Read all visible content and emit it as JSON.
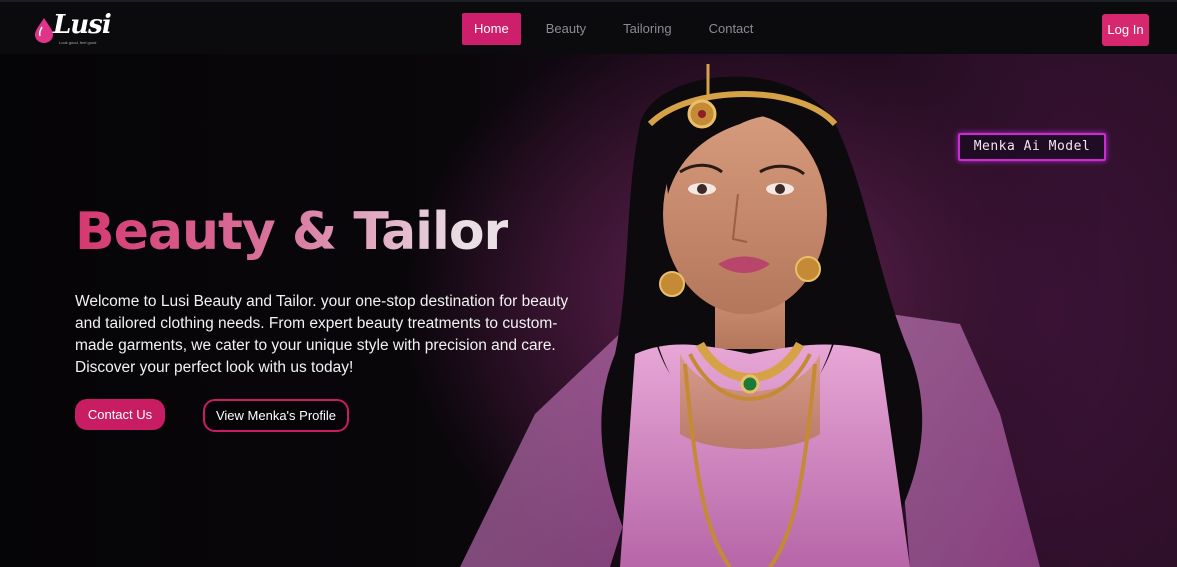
{
  "brand": {
    "name": "Lusi",
    "tagline": "Look good, feel good",
    "colors": {
      "accent": "#cd1f6b",
      "background": "#050406",
      "badge_border": "#c92dd2"
    }
  },
  "nav": {
    "items": [
      {
        "label": "Home",
        "active": true
      },
      {
        "label": "Beauty",
        "active": false
      },
      {
        "label": "Tailoring",
        "active": false
      },
      {
        "label": "Contact",
        "active": false
      }
    ],
    "login_label": "Log In"
  },
  "hero": {
    "title": "Beauty & Tailor",
    "description": "Welcome to Lusi Beauty and Tailor. your one-stop destination for beauty and tailored clothing needs. From expert beauty treatments to custom-made garments, we cater to your unique style with precision and care. Discover your perfect look with us today!",
    "contact_button": "Contact Us",
    "profile_button": "View Menka's Profile",
    "model_badge": "Menka Ai Model",
    "image_icon": "model-portrait-image"
  }
}
